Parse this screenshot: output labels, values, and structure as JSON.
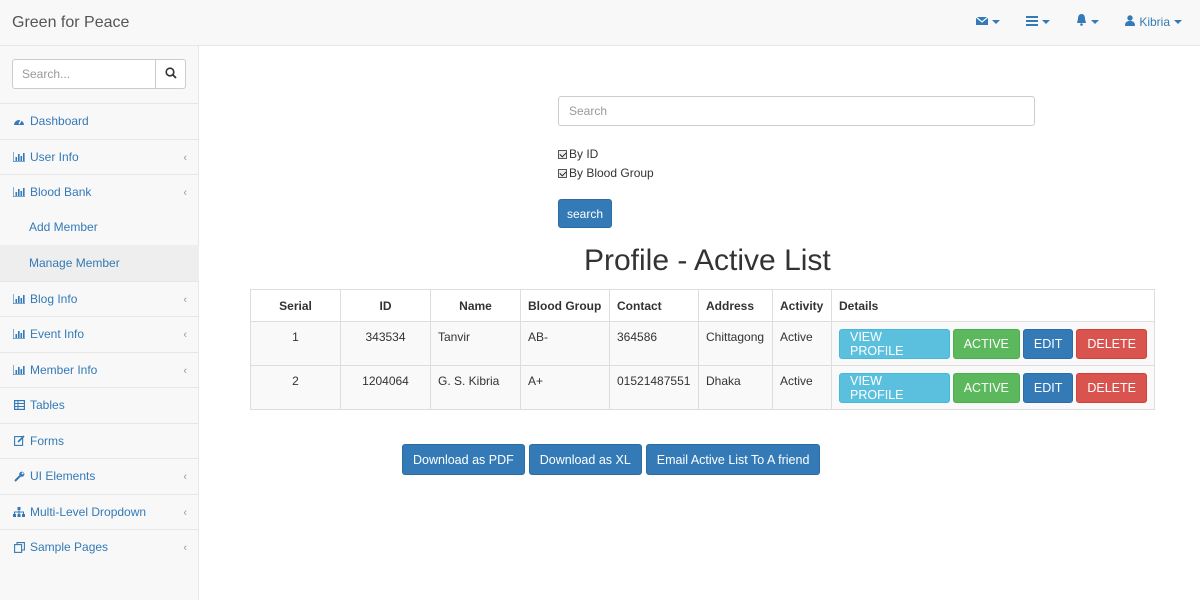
{
  "app": {
    "brand": "Green for Peace"
  },
  "topnav": {
    "user": "Kibria"
  },
  "sidebar": {
    "search_placeholder": "Search...",
    "items": [
      {
        "label": "Dashboard",
        "icon": "dashboard-icon"
      },
      {
        "label": "User Info",
        "icon": "bar-chart-icon"
      },
      {
        "label": "Blood Bank",
        "icon": "bar-chart-icon"
      },
      {
        "label": "Add Member"
      },
      {
        "label": "Manage Member"
      },
      {
        "label": "Blog Info",
        "icon": "bar-chart-icon"
      },
      {
        "label": "Event Info",
        "icon": "bar-chart-icon"
      },
      {
        "label": "Member Info",
        "icon": "bar-chart-icon"
      },
      {
        "label": "Tables",
        "icon": "table-icon"
      },
      {
        "label": "Forms",
        "icon": "edit-icon"
      },
      {
        "label": "UI Elements",
        "icon": "wrench-icon"
      },
      {
        "label": "Multi-Level Dropdown",
        "icon": "sitemap-icon"
      },
      {
        "label": "Sample Pages",
        "icon": "files-icon"
      }
    ]
  },
  "main": {
    "search_placeholder": "Search",
    "filters": {
      "by_id": "By ID",
      "by_blood_group": "By Blood Group"
    },
    "search_button": "search",
    "title": "Profile - Active List",
    "table": {
      "headers": [
        "Serial",
        "ID",
        "Name",
        "Blood Group",
        "Contact",
        "Address",
        "Activity",
        "Details"
      ],
      "rows": [
        {
          "serial": "1",
          "id": "343534",
          "name": "Tanvir",
          "blood_group": "AB-",
          "contact": "364586",
          "address": "Chittagong",
          "activity": "Active"
        },
        {
          "serial": "2",
          "id": "1204064",
          "name": "G. S. Kibria",
          "blood_group": "A+",
          "contact": "01521487551",
          "address": "Dhaka",
          "activity": "Active"
        }
      ],
      "actions": {
        "view": "VIEW PROFILE",
        "active": "ACTIVE",
        "edit": "EDIT",
        "delete": "DELETE"
      }
    },
    "downloads": {
      "pdf": "Download as PDF",
      "xl": "Download as XL",
      "email": "Email Active List To A friend"
    }
  }
}
